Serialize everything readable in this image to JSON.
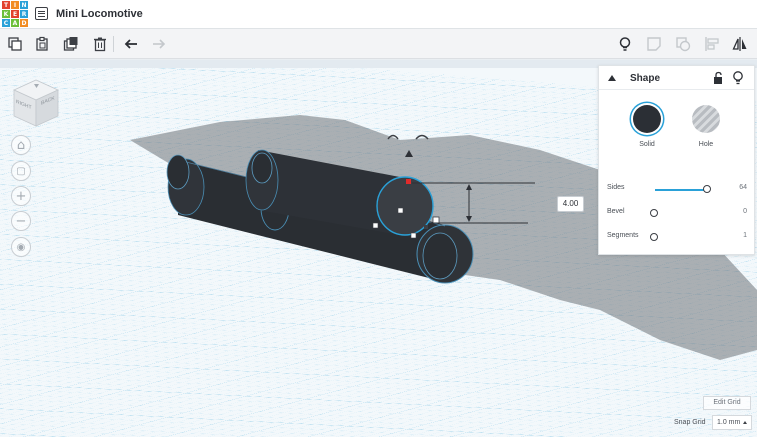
{
  "app": {
    "logo_letters": [
      "T",
      "I",
      "N",
      "K",
      "E",
      "R",
      "C",
      "A",
      "D"
    ],
    "project_title": "Mini Locomotive"
  },
  "toolbar": {
    "left_icons": [
      "copy-icon",
      "paste-icon",
      "duplicate-icon",
      "trash-icon",
      "undo-icon",
      "redo-icon"
    ],
    "right_icons": [
      "lightbulb-icon",
      "note-icon",
      "group-icon",
      "align-icon",
      "mirror-icon"
    ]
  },
  "viewcube": {
    "face_left": "RIGHT",
    "face_right": "BACK"
  },
  "nav": {
    "home": "⌂",
    "fit": "▢",
    "zoom_in": "+",
    "zoom_out": "−",
    "view": "◉"
  },
  "shape_panel": {
    "title": "Shape",
    "solid_label": "Solid",
    "hole_label": "Hole",
    "properties": [
      {
        "name": "Sides",
        "value": "64",
        "slider": 1.0
      },
      {
        "name": "Bevel",
        "value": "0",
        "slider": 0.0
      },
      {
        "name": "Segments",
        "value": "1",
        "slider": 0.0
      }
    ]
  },
  "dimension_readout": "4.00",
  "footer": {
    "edit_grid": "Edit Grid",
    "snap_label": "Snap Grid",
    "snap_value": "1.0 mm"
  },
  "colors": {
    "accent": "#2aa1d8",
    "shape": "#2b2f35",
    "grid_major": "#a9d8ee",
    "grid_minor": "#cfe9f5"
  }
}
